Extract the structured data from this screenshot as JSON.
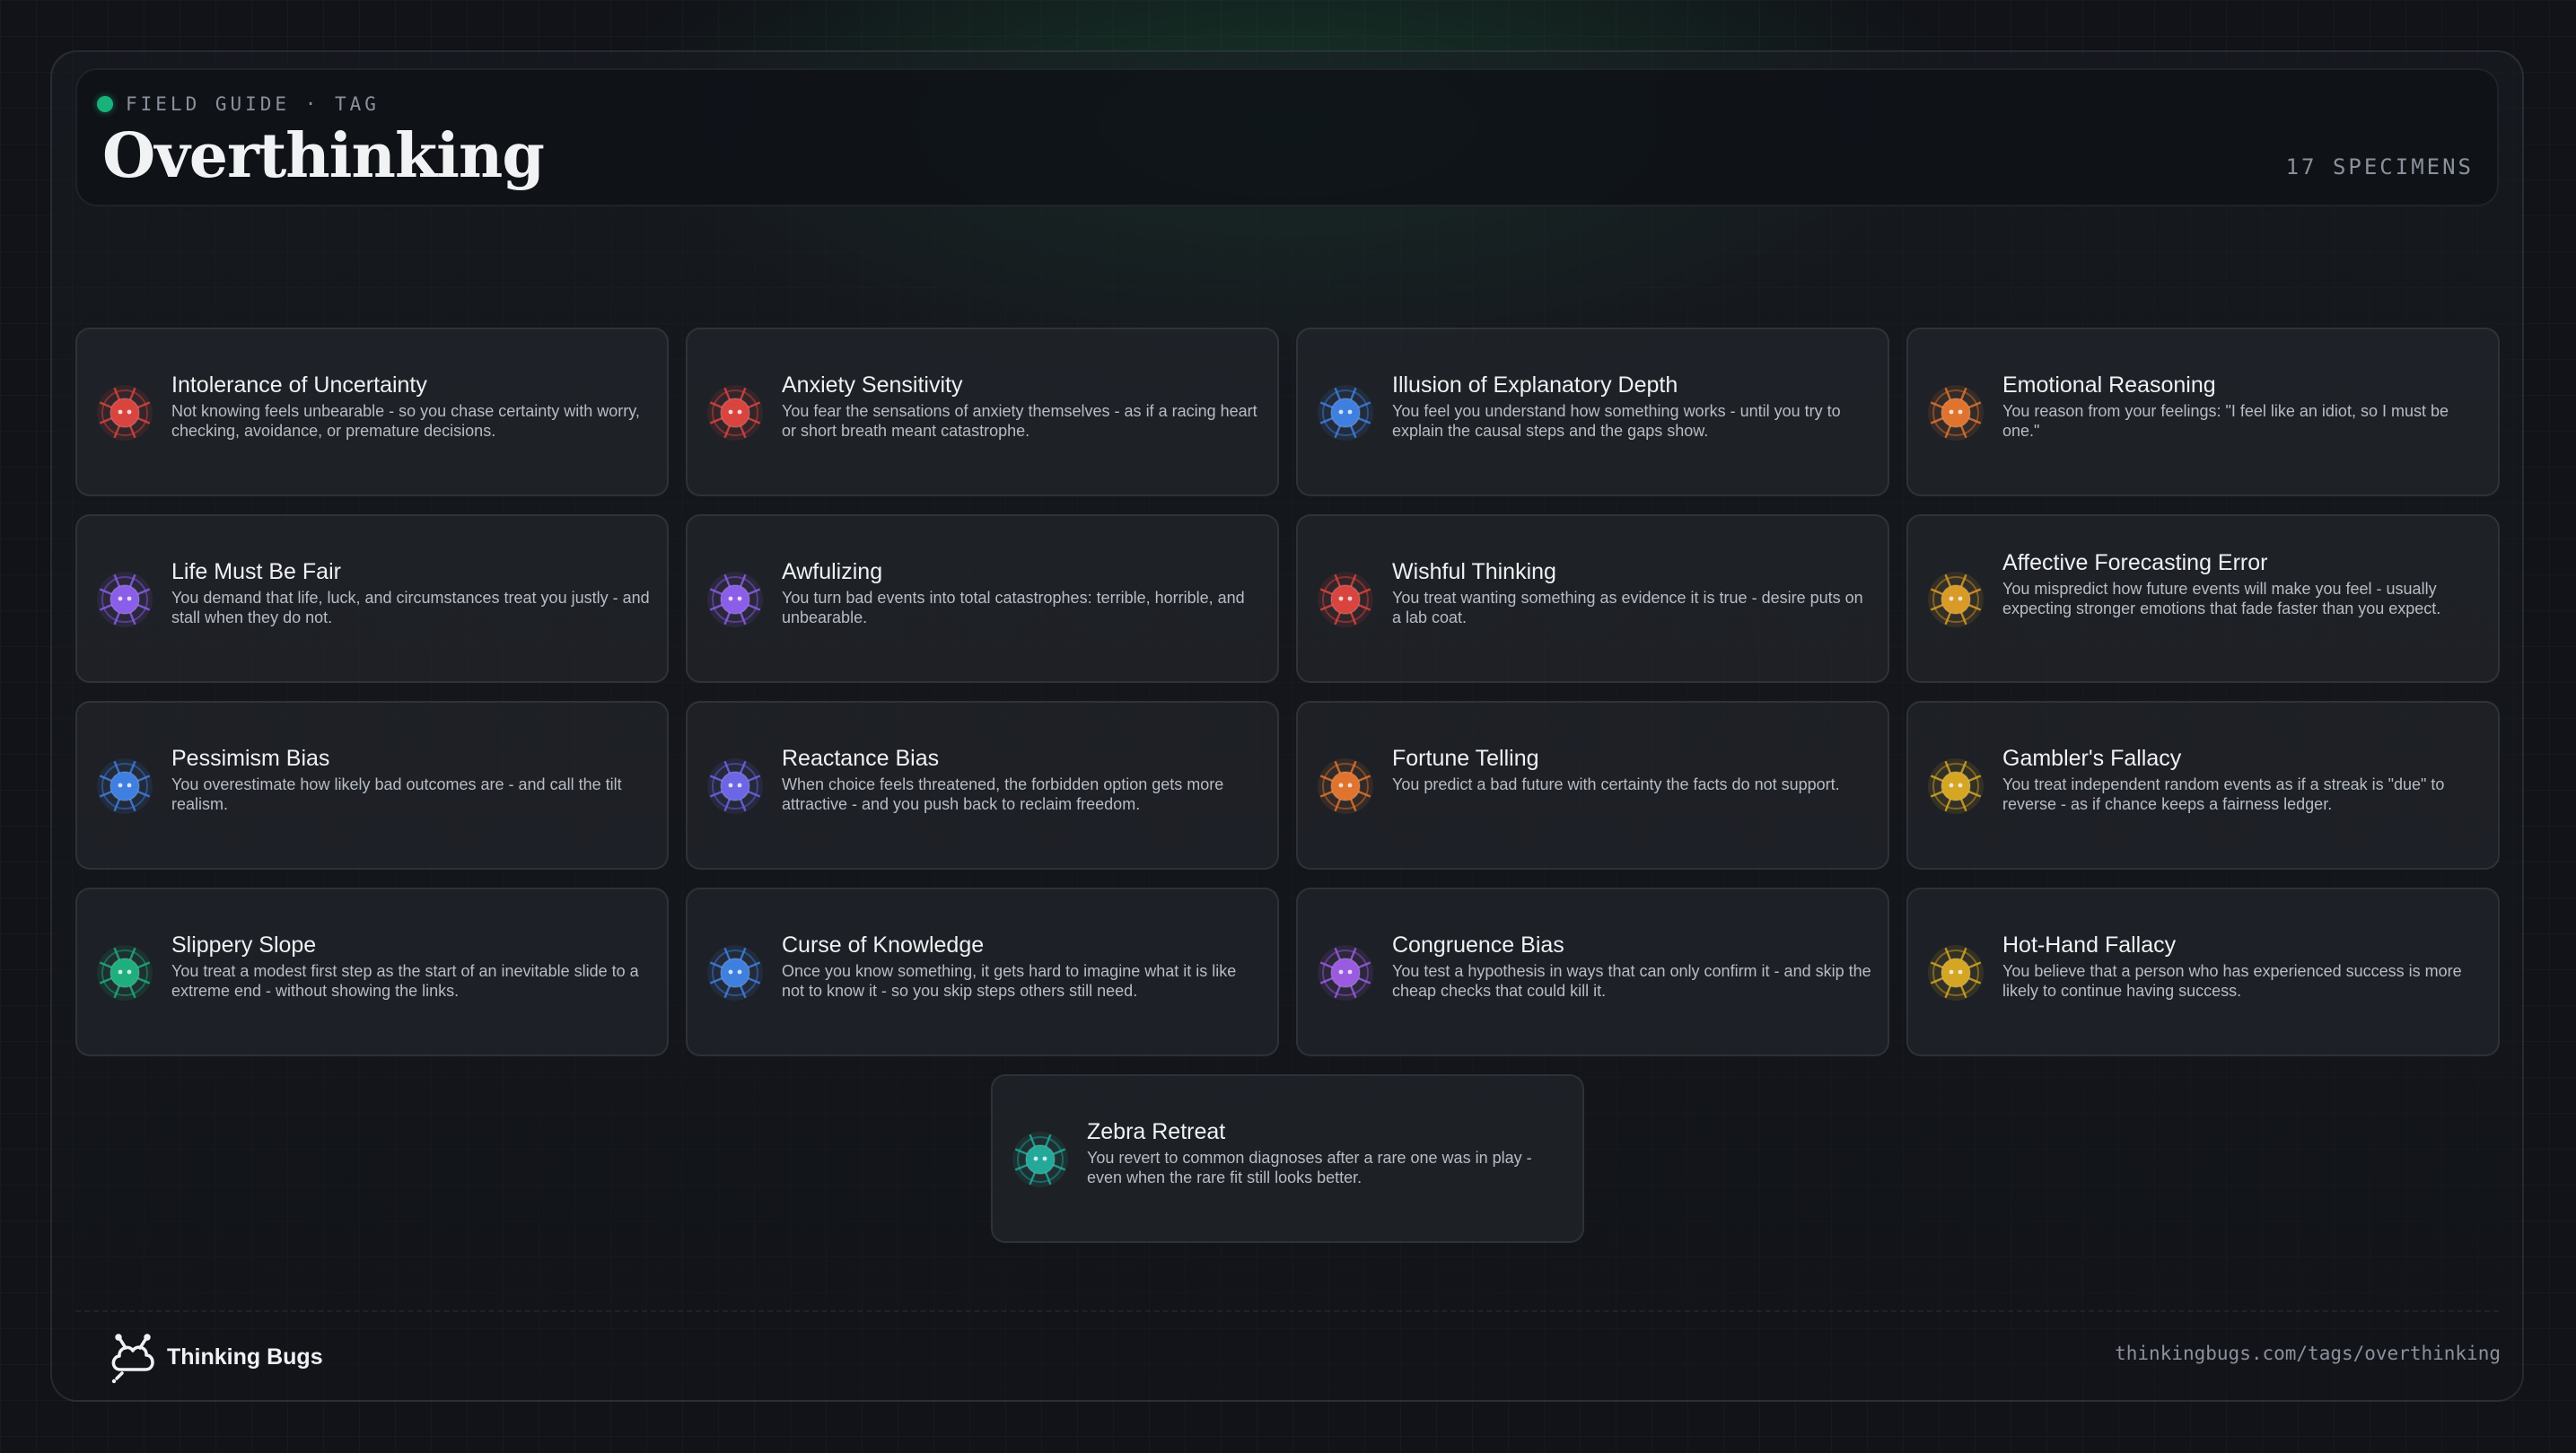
{
  "header": {
    "kicker": "FIELD GUIDE · TAG",
    "title": "Overthinking",
    "count": "17 SPECIMENS"
  },
  "cards": [
    {
      "title": "Intolerance of Uncertainty",
      "desc": "Not knowing feels unbearable - so you chase certainty with worry, checking, avoidance, or premature decisions.",
      "color": "#d9443f",
      "icon": "red-bug-icon"
    },
    {
      "title": "Anxiety Sensitivity",
      "desc": "You fear the sensations of anxiety themselves - as if a racing heart or short breath meant catastrophe.",
      "color": "#d9443f",
      "icon": "red-bug-icon"
    },
    {
      "title": "Illusion of Explanatory Depth",
      "desc": "You feel you understand how something works - until you try to explain the causal steps and the gaps show.",
      "color": "#3f7fe0",
      "icon": "blue-bug-icon"
    },
    {
      "title": "Emotional Reasoning",
      "desc": "You reason from your feelings: \"I feel like an idiot, so I must be one.\"",
      "color": "#e0742e",
      "icon": "orange-bug-icon"
    },
    {
      "title": "Life Must Be Fair",
      "desc": "You demand that life, luck, and circumstances treat you justly - and stall when they do not.",
      "color": "#8a5ee8",
      "icon": "purple-bug-icon"
    },
    {
      "title": "Awfulizing",
      "desc": "You turn bad events into total catastrophes: terrible, horrible, and unbearable.",
      "color": "#8a5ee8",
      "icon": "purple-bug-icon"
    },
    {
      "title": "Wishful Thinking",
      "desc": "You treat wanting something as evidence it is true - desire puts on a lab coat.",
      "color": "#d9443f",
      "icon": "red-bug-icon"
    },
    {
      "title": "Affective Forecasting Error",
      "desc": "You mispredict how future events will make you feel - usually expecting stronger emotions that fade faster than you expect.",
      "color": "#d99a26",
      "icon": "amber-bug-icon"
    },
    {
      "title": "Pessimism Bias",
      "desc": "You overestimate how likely bad outcomes are - and call the tilt realism.",
      "color": "#3f7fe0",
      "icon": "blue-bug-icon"
    },
    {
      "title": "Reactance Bias",
      "desc": "When choice feels threatened, the forbidden option gets more attractive - and you push back to reclaim freedom.",
      "color": "#6c66e6",
      "icon": "indigo-bug-icon"
    },
    {
      "title": "Fortune Telling",
      "desc": "You predict a bad future with certainty the facts do not support.",
      "color": "#e0742e",
      "icon": "orange-bug-icon"
    },
    {
      "title": "Gambler's Fallacy",
      "desc": "You treat independent random events as if a streak is \"due\" to reverse - as if chance keeps a fairness ledger.",
      "color": "#d4a623",
      "icon": "amber-bug-icon"
    },
    {
      "title": "Slippery Slope",
      "desc": "You treat a modest first step as the start of an inevitable slide to a extreme end - without showing the links.",
      "color": "#1fae7e",
      "icon": "green-bug-icon"
    },
    {
      "title": "Curse of Knowledge",
      "desc": "Once you know something, it gets hard to imagine what it is like not to know it - so you skip steps others still need.",
      "color": "#3f7fe0",
      "icon": "blue-bug-icon"
    },
    {
      "title": "Congruence Bias",
      "desc": "You test a hypothesis in ways that can only confirm it - and skip the cheap checks that could kill it.",
      "color": "#9a5be0",
      "icon": "purple-bug-icon"
    },
    {
      "title": "Hot-Hand Fallacy",
      "desc": "You believe that a person who has experienced success is more likely to continue having success.",
      "color": "#d4a623",
      "icon": "amber-bug-icon"
    },
    {
      "title": "Zebra Retreat",
      "desc": "You revert to common diagnoses after a rare one was in play - even when the rare fit still looks better.",
      "color": "#22a99a",
      "icon": "teal-bug-icon"
    }
  ],
  "footer": {
    "brand": "Thinking Bugs",
    "logo_icon": "cloud-bug-logo-icon",
    "url": "thinkingbugs.com/tags/overthinking"
  }
}
